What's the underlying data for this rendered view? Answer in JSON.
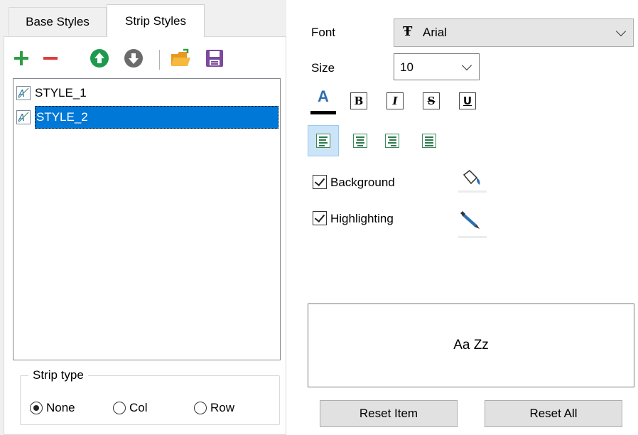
{
  "tabs": [
    {
      "label": "Base Styles",
      "active": false
    },
    {
      "label": "Strip Styles",
      "active": true
    }
  ],
  "toolbar": [
    {
      "icon": "add-icon",
      "color": "#2e9e45"
    },
    {
      "icon": "remove-icon",
      "color": "#e03c3c"
    },
    {
      "icon": "move-up-icon",
      "color": "#1e9a4e"
    },
    {
      "icon": "move-down-icon",
      "color": "#666666"
    },
    {
      "icon": "open-folder-icon",
      "color": "#f0a830"
    },
    {
      "icon": "save-icon",
      "color": "#7b4a9e"
    }
  ],
  "styles_list": {
    "items": [
      {
        "label": "STYLE_1",
        "selected": false
      },
      {
        "label": "STYLE_2",
        "selected": true
      }
    ]
  },
  "strip_type": {
    "title": "Strip type",
    "options": [
      {
        "label": "None",
        "checked": true
      },
      {
        "label": "Col",
        "checked": false
      },
      {
        "label": "Row",
        "checked": false
      }
    ]
  },
  "font": {
    "label": "Font",
    "value": "Arial"
  },
  "size": {
    "label": "Size",
    "value": "10"
  },
  "format_buttons": {
    "color": "A",
    "bold": "B",
    "italic": "I",
    "strike": "S",
    "underline": "U"
  },
  "background": {
    "label": "Background",
    "checked": true
  },
  "highlighting": {
    "label": "Highlighting",
    "checked": true
  },
  "preview": {
    "text": "Aa Zz"
  },
  "buttons": {
    "reset_item": "Reset Item",
    "reset_all": "Reset All"
  },
  "colors": {
    "accent": "#0078d7",
    "font_color_bar": "#000000",
    "align_active_bg": "#cce4f7"
  }
}
